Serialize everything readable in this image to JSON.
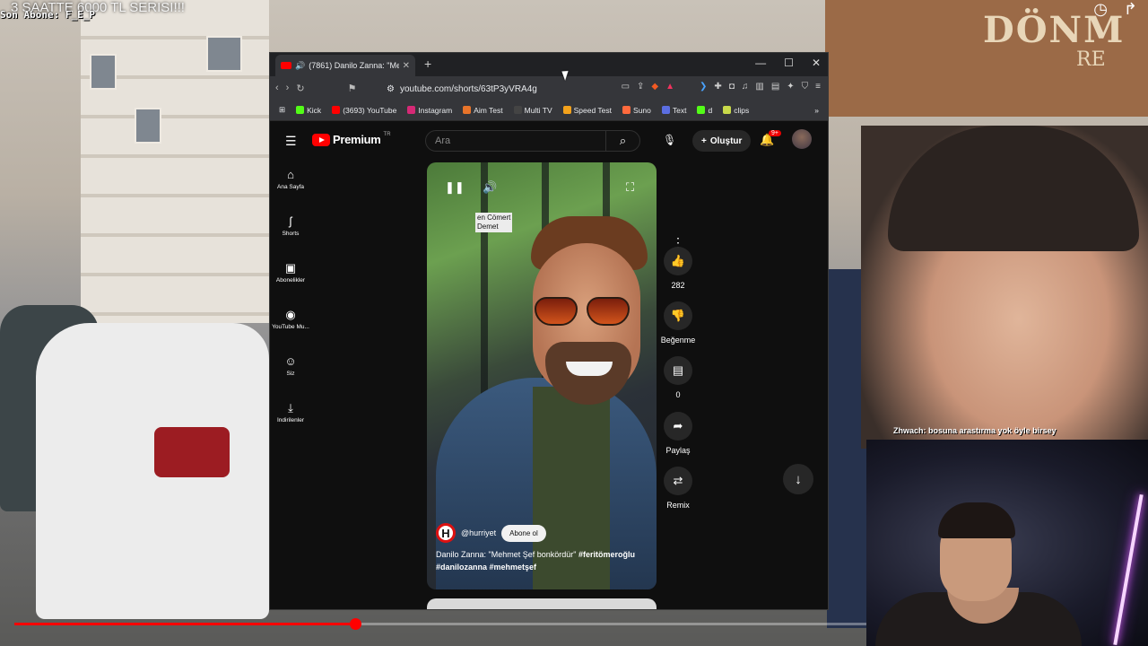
{
  "stream": {
    "title": "3 SAATTE 6000 TL SERISI!!!",
    "subscriber_overlay": "Son Abone: F_E_P",
    "sign_text": "DÖNM",
    "sign_sub": "RE",
    "chat_user": "Zhwach:",
    "chat_text": "bosuna arastırma yok öyle birsey",
    "progress": 0.4
  },
  "browser": {
    "tab_title": "(7861) Danilo Zanna: \"Mehme",
    "url": "youtube.com/shorts/63tP3yVRA4g",
    "bookmarks": [
      {
        "label": "Kick",
        "color": "#53fc18"
      },
      {
        "label": "(3693) YouTube",
        "color": "#ff0000"
      },
      {
        "label": "Instagram",
        "color": "#d62976"
      },
      {
        "label": "Aim Test",
        "color": "#e8742a"
      },
      {
        "label": "Multi TV",
        "color": "#444444"
      },
      {
        "label": "Speed Test",
        "color": "#f3a21c"
      },
      {
        "label": "Suno",
        "color": "#ff6a3d"
      },
      {
        "label": "Text",
        "color": "#5b6ee1"
      },
      {
        "label": "d",
        "color": "#53fc18"
      },
      {
        "label": "clips",
        "color": "#c8d94a"
      }
    ]
  },
  "youtube": {
    "logo_text": "Premium",
    "logo_region": "TR",
    "search_placeholder": "Ara",
    "create_label": "Oluştur",
    "notif_badge": "9+",
    "sidebar": [
      {
        "label": "Ana Sayfa",
        "icon": "home-icon",
        "glyph": "⌂"
      },
      {
        "label": "Shorts",
        "icon": "shorts-icon",
        "glyph": "ʃ"
      },
      {
        "label": "Abonelikler",
        "icon": "subscriptions-icon",
        "glyph": "▣"
      },
      {
        "label": "YouTube Mu...",
        "icon": "music-icon",
        "glyph": "◉"
      },
      {
        "label": "Siz",
        "icon": "you-icon",
        "glyph": "☺"
      },
      {
        "label": "İndirilenler",
        "icon": "downloads-icon",
        "glyph": "⤓"
      }
    ],
    "short": {
      "caption_tag_line1": "en Cömert",
      "caption_tag_line2": "Demet",
      "channel": "@hurriyet",
      "subscribe_label": "Abone ol",
      "description": "Danilo Zanna: \"Mehmet Şef bonkördür\"",
      "hashtag1": "#feritömeroğlu",
      "hashtags2": "#danilozanna #mehmetşef"
    },
    "actions": {
      "likes": "282",
      "dislike_label": "Beğenme",
      "comments": "0",
      "share_label": "Paylaş",
      "remix_label": "Remix"
    }
  }
}
